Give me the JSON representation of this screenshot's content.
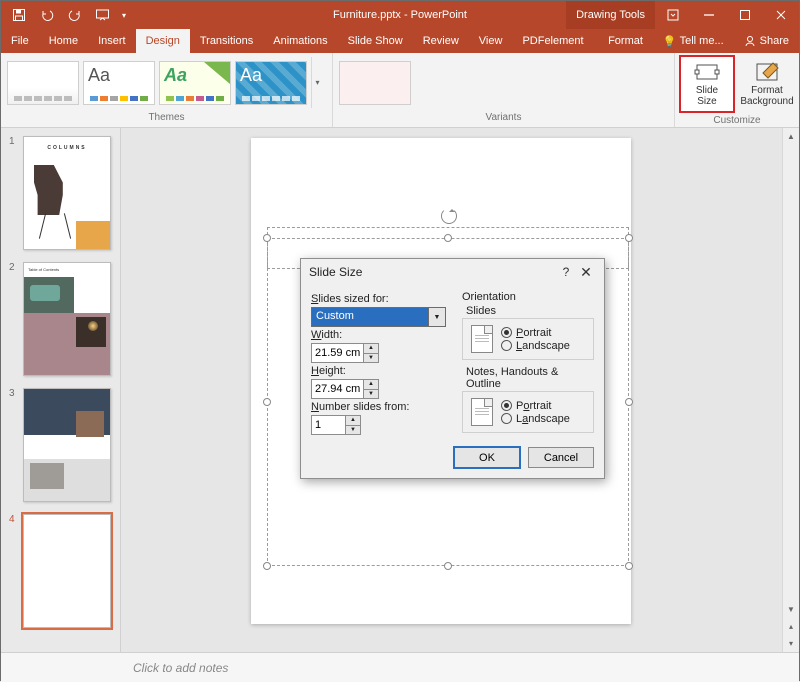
{
  "app": {
    "title": "Furniture.pptx - PowerPoint",
    "context_tab": "Drawing Tools"
  },
  "winctrl": {},
  "tabs": {
    "file": "File",
    "home": "Home",
    "insert": "Insert",
    "design": "Design",
    "transitions": "Transitions",
    "animations": "Animations",
    "slideshow": "Slide Show",
    "review": "Review",
    "view": "View",
    "pdfelement": "PDFelement",
    "format": "Format",
    "tellme": "Tell me...",
    "share": "Share"
  },
  "ribbon": {
    "themes_label": "Themes",
    "variants_label": "Variants",
    "customize_label": "Customize",
    "slide_size": "Slide\nSize",
    "format_bg": "Format\nBackground",
    "aa": "Aa"
  },
  "thumbs": {
    "n1": "1",
    "n2": "2",
    "n3": "3",
    "n4": "4",
    "s1_title": "COLUMNS",
    "s2_toc": "Table of Contents"
  },
  "dialog": {
    "title": "Slide Size",
    "help": "?",
    "close": "✕",
    "sized_for": "Slides sized for:",
    "custom": "Custom",
    "width": "Width:",
    "width_v": "21.59 cm",
    "height": "Height:",
    "height_v": "27.94 cm",
    "numfrom": "Number slides from:",
    "numfrom_v": "1",
    "orientation": "Orientation",
    "slides": "Slides",
    "notes": "Notes, Handouts & Outline",
    "portrait": "Portrait",
    "landscape": "Landscape",
    "ok": "OK",
    "cancel": "Cancel"
  },
  "notes": {
    "placeholder": "Click to add notes"
  }
}
